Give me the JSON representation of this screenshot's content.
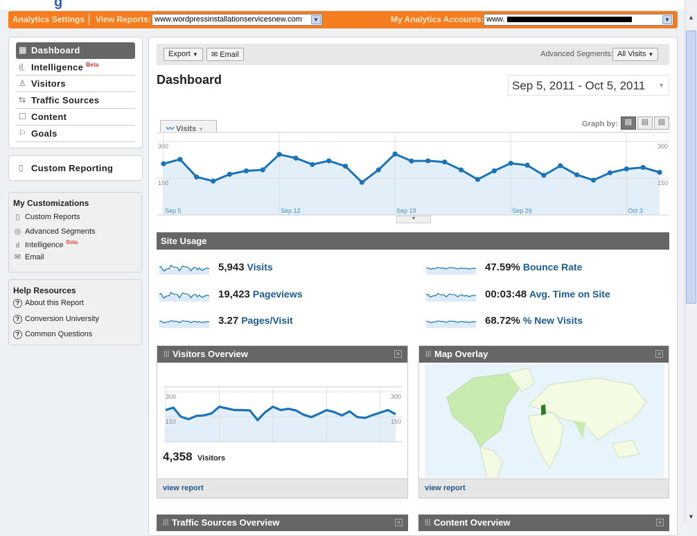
{
  "header": {
    "analytics_settings": "Analytics Settings",
    "view_reports_label": "View Reports:",
    "view_reports_value": "www.wordpressinstallationservicesnew.com",
    "my_accounts_label": "My Analytics Accounts:",
    "my_accounts_value": "www."
  },
  "sidebar": {
    "nav": [
      {
        "label": "Dashboard",
        "icon": "grid-icon"
      },
      {
        "label": "Intelligence",
        "badge": "Beta",
        "icon": "intelligence-icon"
      },
      {
        "label": "Visitors",
        "icon": "person-icon"
      },
      {
        "label": "Traffic Sources",
        "icon": "arrows-icon"
      },
      {
        "label": "Content",
        "icon": "page-icon"
      },
      {
        "label": "Goals",
        "icon": "flag-icon"
      }
    ],
    "custom_reporting": "Custom Reporting",
    "customizations": {
      "title": "My Customizations",
      "items": [
        {
          "label": "Custom Reports"
        },
        {
          "label": "Advanced Segments"
        },
        {
          "label": "Intelligence",
          "badge": "Beta"
        },
        {
          "label": "Email"
        }
      ]
    },
    "help": {
      "title": "Help Resources",
      "items": [
        {
          "label": "About this Report"
        },
        {
          "label": "Conversion University"
        },
        {
          "label": "Common Questions"
        }
      ]
    }
  },
  "toolbar": {
    "export": "Export",
    "email": "Email",
    "segments_label": "Advanced Segments:",
    "segments_value": "All Visits"
  },
  "page_title": "Dashboard",
  "date_range": "Sep 5, 2011 - Oct 5, 2011",
  "graph": {
    "metric": "Visits",
    "graph_by": "Graph by:"
  },
  "chart_data": [
    {
      "type": "area",
      "title": "Visits",
      "x_labels": [
        "Sep 5",
        "Sep 12",
        "Sep 19",
        "Sep 26",
        "Oct 3"
      ],
      "y_ticks": [
        "300",
        "150"
      ],
      "ylim": [
        0,
        300
      ],
      "values": [
        209,
        227,
        155,
        138,
        166,
        180,
        184,
        247,
        232,
        206,
        221,
        199,
        133,
        184,
        249,
        220,
        221,
        216,
        184,
        145,
        180,
        211,
        203,
        162,
        201,
        164,
        142,
        172,
        188,
        194,
        174
      ]
    },
    {
      "type": "area",
      "title": "Visitors",
      "y_ticks": [
        "300",
        "150"
      ],
      "ylim": [
        0,
        300
      ],
      "values": [
        190,
        205,
        150,
        135,
        155,
        158,
        170,
        210,
        200,
        190,
        190,
        188,
        130,
        178,
        210,
        190,
        198,
        188,
        162,
        148,
        168,
        190,
        178,
        158,
        182,
        148,
        143,
        160,
        175,
        190,
        165
      ]
    }
  ],
  "site_usage": {
    "title": "Site Usage",
    "metrics": [
      {
        "value": "5,943",
        "label": "Visits"
      },
      {
        "value": "19,423",
        "label": "Pageviews"
      },
      {
        "value": "3.27",
        "label": "Pages/Visit"
      },
      {
        "value": "47.59%",
        "label": "Bounce Rate"
      },
      {
        "value": "00:03:48",
        "label": "Avg. Time on Site"
      },
      {
        "value": "68.72%",
        "label": "% New Visits"
      }
    ]
  },
  "widgets": {
    "visitors": {
      "title": "Visitors Overview",
      "count": "4,358",
      "count_label": "Visitors",
      "link": "view report"
    },
    "map": {
      "title": "Map Overlay",
      "link": "view report"
    },
    "traffic": {
      "title": "Traffic Sources Overview"
    },
    "content": {
      "title": "Content Overview"
    }
  },
  "colors": {
    "orange": "#f57c1f",
    "line": "#1a73b8",
    "fill": "#e2eff9",
    "link": "#1a5c94"
  }
}
